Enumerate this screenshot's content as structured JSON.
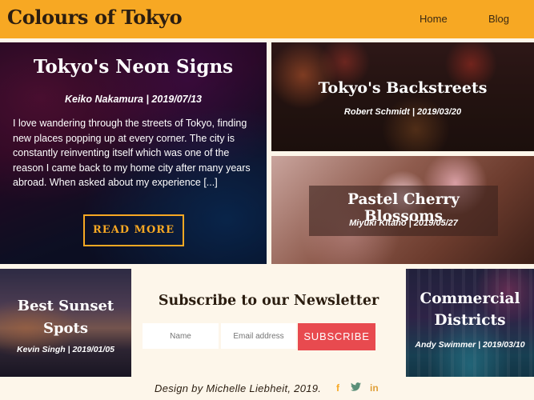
{
  "header": {
    "brand": "Colours of Tokyo",
    "nav": [
      "Home",
      "Blog"
    ]
  },
  "posts": {
    "neon": {
      "title": "Tokyo's Neon Signs",
      "meta": "Keiko Nakamura | 2019/07/13",
      "excerpt": "I love wandering through the streets of Tokyo, finding new places popping up at every corner. The city is constantly reinventing itself which was one of the reason I came back to my home city after many years abroad. When asked about my experience [...]",
      "cta": "READ MORE"
    },
    "backstreets": {
      "title": "Tokyo's Backstreets",
      "meta": "Robert Schmidt | 2019/03/20"
    },
    "cherry": {
      "title": "Pastel Cherry Blossoms",
      "meta": "Miyuki Kitano | 2019/05/27"
    },
    "sunset": {
      "title": "Best Sunset Spots",
      "meta": "Kevin Singh | 2019/01/05"
    },
    "commercial": {
      "title": "Commercial Districts",
      "meta": "Andy Swimmer | 2019/03/10"
    }
  },
  "newsletter": {
    "title": "Subscribe to our Newsletter",
    "name_placeholder": "Name",
    "email_placeholder": "Email address",
    "button": "SUBSCRIBE"
  },
  "footer": {
    "credit": "Design by Michelle Liebheit, 2019.",
    "social": [
      {
        "icon": "facebook-icon",
        "glyph": "f"
      },
      {
        "icon": "twitter-icon",
        "glyph": "🐦"
      },
      {
        "icon": "linkedin-icon",
        "glyph": "in"
      }
    ]
  },
  "colors": {
    "accent": "#f7a823",
    "background": "#fdf6ea",
    "subscribe": "#e84a4f"
  }
}
